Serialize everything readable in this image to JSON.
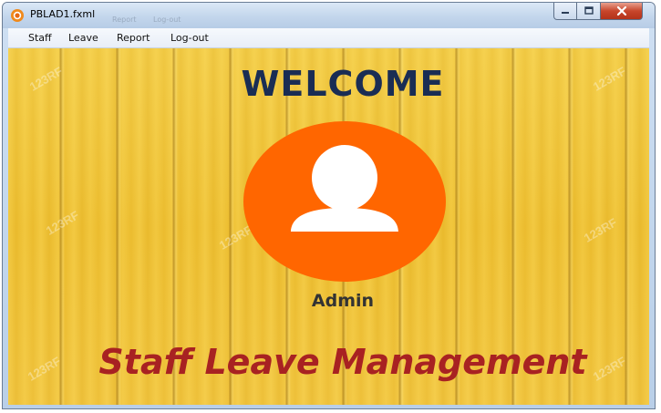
{
  "window": {
    "title": "PBLAD1.fxml",
    "ghost_texts": [
      "Report",
      "Log-out"
    ]
  },
  "menu": {
    "items": [
      {
        "label": "Staff"
      },
      {
        "label": "Leave"
      },
      {
        "label": "Report"
      },
      {
        "label": "Log-out"
      }
    ]
  },
  "main": {
    "heading": "WELCOME",
    "user_label": "Admin",
    "app_title": "Staff Leave Management",
    "watermark": "123RF"
  },
  "colors": {
    "heading": "#1a2d54",
    "avatar_circle": "#ff6600",
    "app_title": "#a82222",
    "background": "#f0c63a"
  },
  "icons": {
    "app": "javafx-app-icon",
    "avatar": "user-silhouette-icon"
  }
}
